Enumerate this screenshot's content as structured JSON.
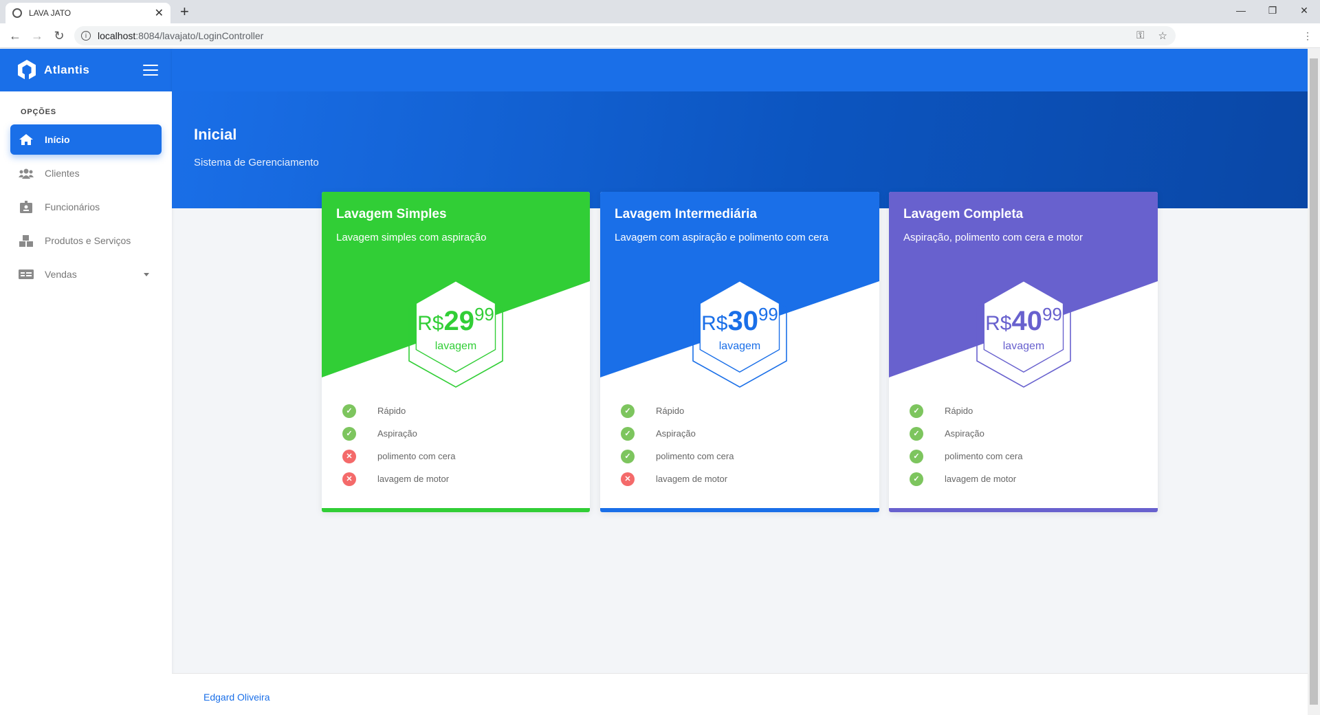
{
  "browser": {
    "tab_title": "LAVA JATO",
    "url_host": "localhost",
    "url_path": ":8084/lavajato/LoginController"
  },
  "app": {
    "brand": "Atlantis",
    "sidebar": {
      "section": "OPÇÕES",
      "items": [
        {
          "label": "Início",
          "icon": "home-icon",
          "active": true
        },
        {
          "label": "Clientes",
          "icon": "users-icon"
        },
        {
          "label": "Funcionários",
          "icon": "id-badge-icon"
        },
        {
          "label": "Produtos e Serviços",
          "icon": "boxes-icon"
        },
        {
          "label": "Vendas",
          "icon": "money-icon",
          "has_caret": true
        }
      ]
    },
    "page": {
      "title": "Inicial",
      "subtitle": "Sistema de Gerenciamento"
    },
    "cards": [
      {
        "title": "Lavagem Simples",
        "subtitle": "Lavagem simples com aspiração",
        "currency": "R$",
        "price_int": "29",
        "price_dec": "99",
        "unit": "lavagem",
        "color": "#31ce36",
        "features": [
          {
            "label": "Rápido",
            "included": true
          },
          {
            "label": "Aspiração",
            "included": true
          },
          {
            "label": "polimento com cera",
            "included": false
          },
          {
            "label": "lavagem de motor",
            "included": false
          }
        ]
      },
      {
        "title": "Lavagem Intermediária",
        "subtitle": "Lavagem com aspiração e polimento com cera",
        "currency": "R$",
        "price_int": "30",
        "price_dec": "99",
        "unit": "lavagem",
        "color": "#1a6fe8",
        "features": [
          {
            "label": "Rápido",
            "included": true
          },
          {
            "label": "Aspiração",
            "included": true
          },
          {
            "label": "polimento com cera",
            "included": true
          },
          {
            "label": "lavagem de motor",
            "included": false
          }
        ]
      },
      {
        "title": "Lavagem Completa",
        "subtitle": "Aspiração, polimento com cera e motor",
        "currency": "R$",
        "price_int": "40",
        "price_dec": "99",
        "unit": "lavagem",
        "color": "#6861ce",
        "features": [
          {
            "label": "Rápido",
            "included": true
          },
          {
            "label": "Aspiração",
            "included": true
          },
          {
            "label": "polimento com cera",
            "included": true
          },
          {
            "label": "lavagem de motor",
            "included": true
          }
        ]
      }
    ],
    "footer": {
      "author": "Edgard Oliveira"
    }
  }
}
